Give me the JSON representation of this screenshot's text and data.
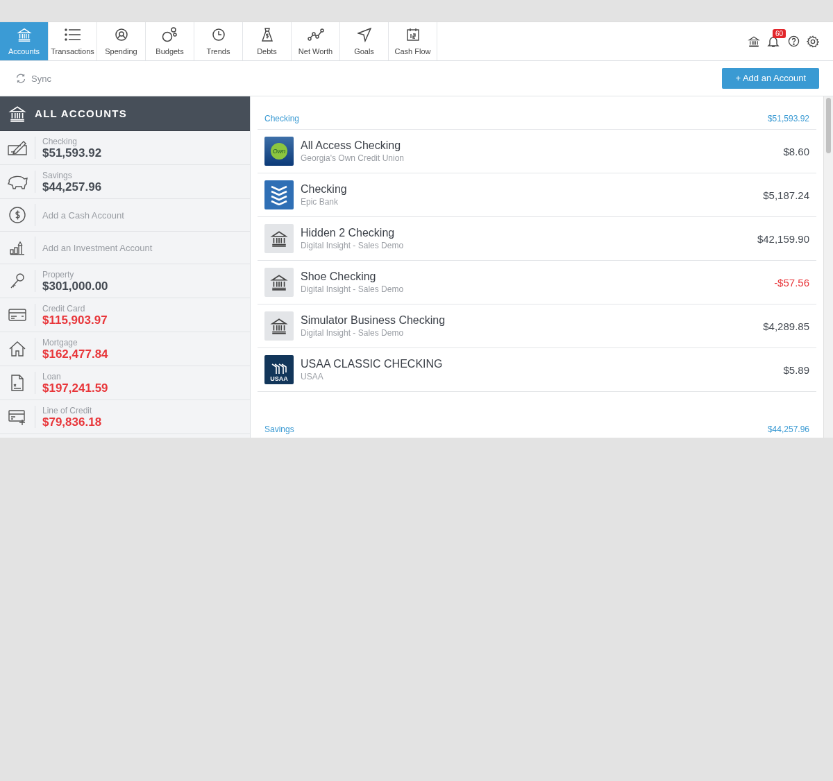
{
  "nav": {
    "tabs": [
      {
        "label": "Accounts",
        "selected": true
      },
      {
        "label": "Transactions",
        "selected": false
      },
      {
        "label": "Spending",
        "selected": false
      },
      {
        "label": "Budgets",
        "selected": false
      },
      {
        "label": "Trends",
        "selected": false
      },
      {
        "label": "Debts",
        "selected": false
      },
      {
        "label": "Net Worth",
        "selected": false
      },
      {
        "label": "Goals",
        "selected": false
      },
      {
        "label": "Cash Flow",
        "selected": false
      }
    ],
    "notification_count": "60"
  },
  "toolbar": {
    "sync": "Sync",
    "add_button": "+ Add an Account"
  },
  "sidebar": {
    "title": "ALL ACCOUNTS",
    "items": [
      {
        "kind": "balance",
        "label": "Checking",
        "amount": "$51,593.92",
        "negative": false
      },
      {
        "kind": "balance",
        "label": "Savings",
        "amount": "$44,257.96",
        "negative": false
      },
      {
        "kind": "add",
        "label": "Add a Cash Account"
      },
      {
        "kind": "add",
        "label": "Add an Investment Account"
      },
      {
        "kind": "balance",
        "label": "Property",
        "amount": "$301,000.00",
        "negative": false
      },
      {
        "kind": "balance",
        "label": "Credit Card",
        "amount": "$115,903.97",
        "negative": true
      },
      {
        "kind": "balance",
        "label": "Mortgage",
        "amount": "$162,477.84",
        "negative": true
      },
      {
        "kind": "balance",
        "label": "Loan",
        "amount": "$197,241.59",
        "negative": true
      },
      {
        "kind": "balance",
        "label": "Line of Credit",
        "amount": "$79,836.18",
        "negative": true
      }
    ]
  },
  "groups": [
    {
      "name": "Checking",
      "total": "$51,593.92",
      "accounts": [
        {
          "kind": "own",
          "logo_text": "Own",
          "name": "All Access Checking",
          "institution": "Georgia's Own Credit Union",
          "amount": "$8.60",
          "negative": false
        },
        {
          "kind": "chevrons",
          "name": "Checking",
          "institution": "Epic Bank",
          "amount": "$5,187.24",
          "negative": false
        },
        {
          "kind": "bank",
          "name": "Hidden 2 Checking",
          "institution": "Digital Insight - Sales Demo",
          "amount": "$42,159.90",
          "negative": false
        },
        {
          "kind": "bank",
          "name": "Shoe Checking",
          "institution": "Digital Insight - Sales Demo",
          "amount": "-$57.56",
          "negative": true
        },
        {
          "kind": "bank",
          "name": "Simulator Business Checking",
          "institution": "Digital Insight - Sales Demo",
          "amount": "$4,289.85",
          "negative": false
        },
        {
          "kind": "usaa",
          "logo_text": "USAA",
          "name": "USAA CLASSIC CHECKING",
          "institution": "USAA",
          "amount": "$5.89",
          "negative": false
        }
      ]
    },
    {
      "name": "Savings",
      "total": "$44,257.96"
    }
  ]
}
